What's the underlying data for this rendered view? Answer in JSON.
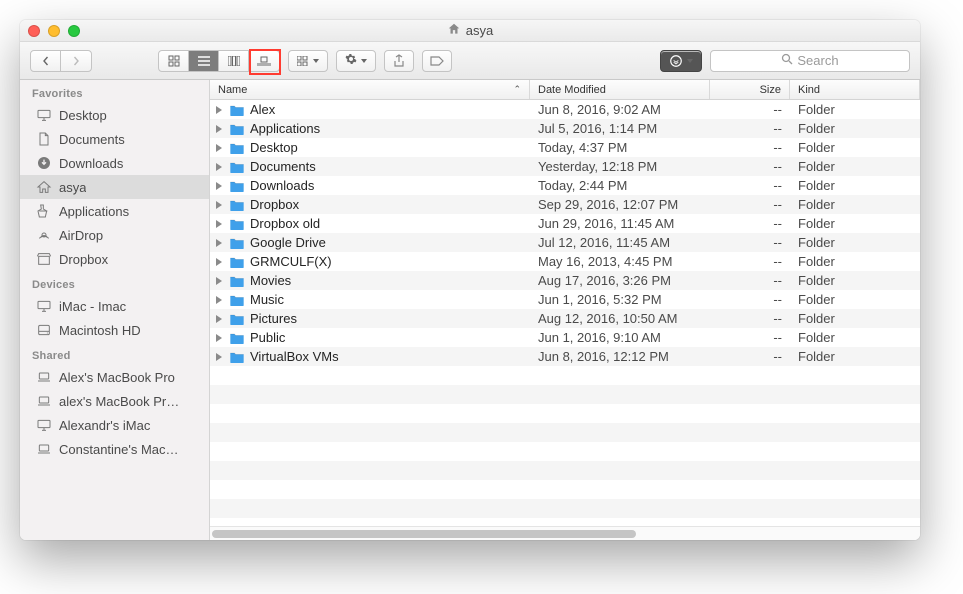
{
  "window": {
    "title": "asya"
  },
  "toolbar": {
    "search_placeholder": "Search"
  },
  "sidebar": {
    "sections": [
      {
        "header": "Favorites",
        "items": [
          {
            "id": "desktop",
            "label": "Desktop",
            "icon": "display",
            "selected": false
          },
          {
            "id": "documents",
            "label": "Documents",
            "icon": "doc",
            "selected": false
          },
          {
            "id": "downloads",
            "label": "Downloads",
            "icon": "download",
            "selected": false
          },
          {
            "id": "asya",
            "label": "asya",
            "icon": "home",
            "selected": true
          },
          {
            "id": "applications",
            "label": "Applications",
            "icon": "apps",
            "selected": false
          },
          {
            "id": "airdrop",
            "label": "AirDrop",
            "icon": "airdrop",
            "selected": false
          },
          {
            "id": "dropbox",
            "label": "Dropbox",
            "icon": "box",
            "selected": false
          }
        ]
      },
      {
        "header": "Devices",
        "items": [
          {
            "id": "imac",
            "label": "iMac - Imac",
            "icon": "display",
            "selected": false
          },
          {
            "id": "machd",
            "label": "Macintosh HD",
            "icon": "disk",
            "selected": false
          }
        ]
      },
      {
        "header": "Shared",
        "items": [
          {
            "id": "s1",
            "label": "Alex's MacBook Pro",
            "icon": "laptop",
            "selected": false
          },
          {
            "id": "s2",
            "label": "alex's MacBook Pr…",
            "icon": "laptop",
            "selected": false
          },
          {
            "id": "s3",
            "label": "Alexandr's iMac",
            "icon": "display",
            "selected": false
          },
          {
            "id": "s4",
            "label": "Constantine's Mac…",
            "icon": "laptop",
            "selected": false
          }
        ]
      }
    ]
  },
  "columns": {
    "name": "Name",
    "date": "Date Modified",
    "size": "Size",
    "kind": "Kind"
  },
  "rows": [
    {
      "name": "Alex",
      "date": "Jun 8, 2016, 9:02 AM",
      "size": "--",
      "kind": "Folder",
      "color": "#3fa0ea"
    },
    {
      "name": "Applications",
      "date": "Jul 5, 2016, 1:14 PM",
      "size": "--",
      "kind": "Folder",
      "color": "#3fa0ea"
    },
    {
      "name": "Desktop",
      "date": "Today, 4:37 PM",
      "size": "--",
      "kind": "Folder",
      "color": "#3fa0ea"
    },
    {
      "name": "Documents",
      "date": "Yesterday, 12:18 PM",
      "size": "--",
      "kind": "Folder",
      "color": "#3fa0ea"
    },
    {
      "name": "Downloads",
      "date": "Today, 2:44 PM",
      "size": "--",
      "kind": "Folder",
      "color": "#3fa0ea"
    },
    {
      "name": "Dropbox",
      "date": "Sep 29, 2016, 12:07 PM",
      "size": "--",
      "kind": "Folder",
      "color": "#3fa0ea"
    },
    {
      "name": "Dropbox old",
      "date": "Jun 29, 2016, 11:45 AM",
      "size": "--",
      "kind": "Folder",
      "color": "#3fa0ea"
    },
    {
      "name": "Google Drive",
      "date": "Jul 12, 2016, 11:45 AM",
      "size": "--",
      "kind": "Folder",
      "color": "#3fa0ea"
    },
    {
      "name": "GRMCULF(X)",
      "date": "May 16, 2013, 4:45 PM",
      "size": "--",
      "kind": "Folder",
      "color": "#3fa0ea"
    },
    {
      "name": "Movies",
      "date": "Aug 17, 2016, 3:26 PM",
      "size": "--",
      "kind": "Folder",
      "color": "#3fa0ea"
    },
    {
      "name": "Music",
      "date": "Jun 1, 2016, 5:32 PM",
      "size": "--",
      "kind": "Folder",
      "color": "#3fa0ea"
    },
    {
      "name": "Pictures",
      "date": "Aug 12, 2016, 10:50 AM",
      "size": "--",
      "kind": "Folder",
      "color": "#3fa0ea"
    },
    {
      "name": "Public",
      "date": "Jun 1, 2016, 9:10 AM",
      "size": "--",
      "kind": "Folder",
      "color": "#3fa0ea"
    },
    {
      "name": "VirtualBox VMs",
      "date": "Jun 8, 2016, 12:12 PM",
      "size": "--",
      "kind": "Folder",
      "color": "#3fa0ea"
    }
  ],
  "annotation": {
    "highlight_view_button": "list"
  }
}
